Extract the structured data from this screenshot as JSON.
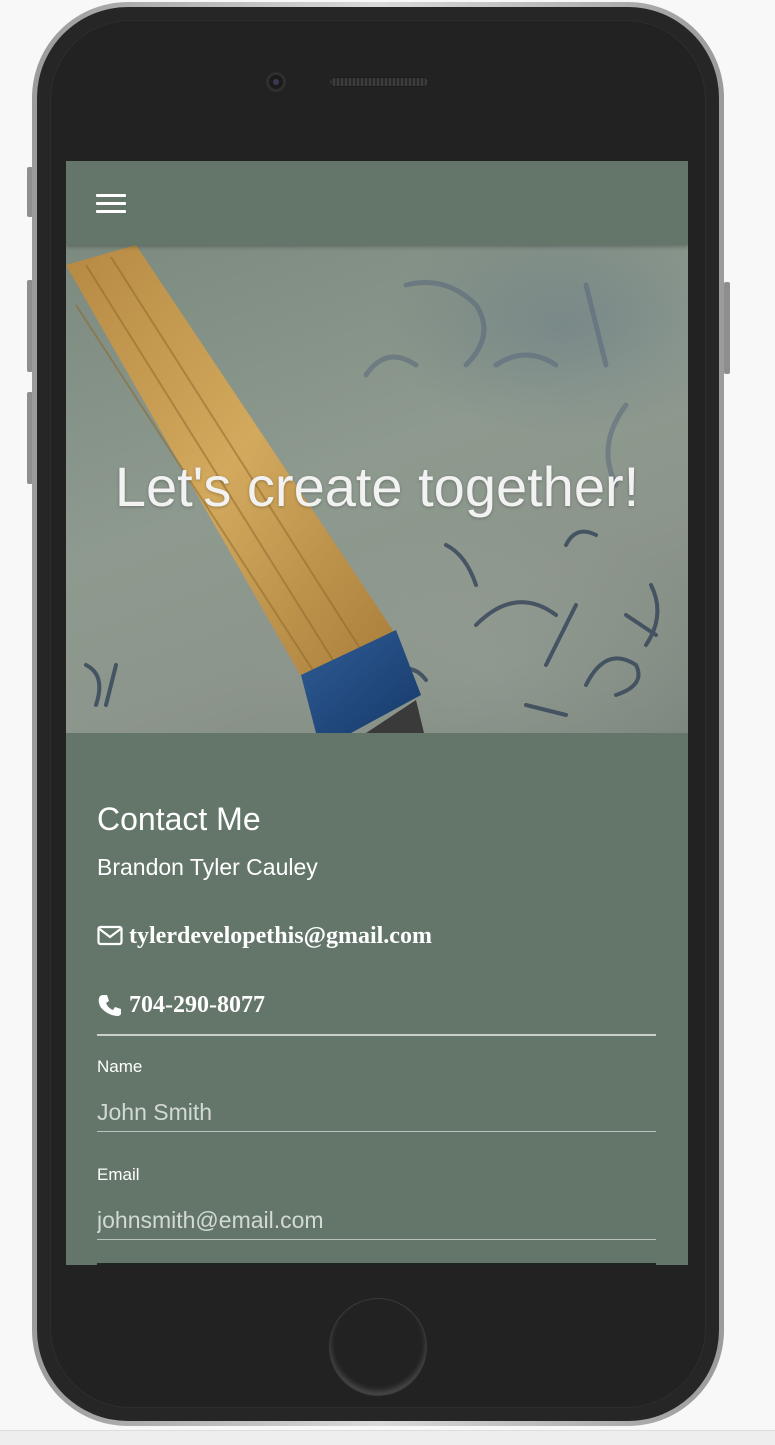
{
  "navbar": {
    "menu_icon": "hamburger-menu-icon"
  },
  "hero": {
    "title": "Let's create together!"
  },
  "contact": {
    "heading": "Contact Me",
    "name": "Brandon Tyler Cauley",
    "email": {
      "icon": "envelope-icon",
      "text": "tylerdevelopethis@gmail.com"
    },
    "phone": {
      "icon": "phone-icon",
      "text": "704-290-8077"
    }
  },
  "form": {
    "name_label": "Name",
    "name_placeholder": "John Smith",
    "email_label": "Email",
    "email_placeholder": "johnsmith@email.com"
  },
  "colors": {
    "theme": "#637669",
    "text": "#ffffff",
    "device_body": "#262626"
  }
}
